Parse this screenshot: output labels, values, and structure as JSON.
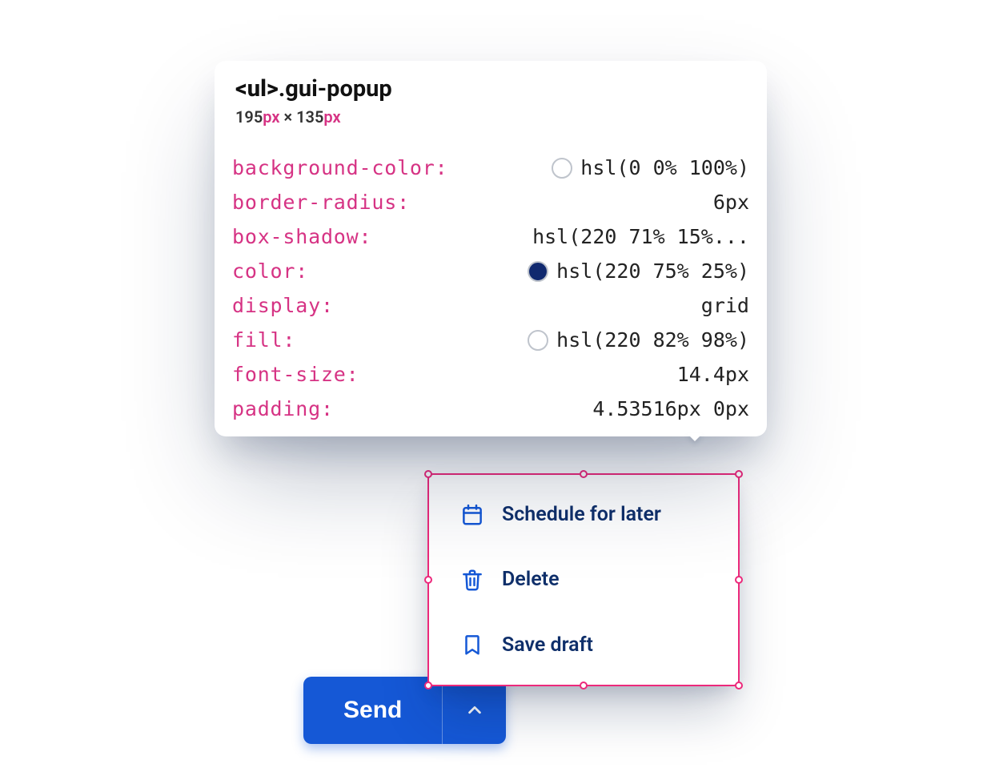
{
  "tooltip": {
    "element_tag": "<ul>",
    "element_class": ".gui-popup",
    "width_num": "195",
    "height_num": "135",
    "px_label": "px",
    "sep": " × ",
    "styles": [
      {
        "prop": "background-color",
        "value": "hsl(0 0% 100%)",
        "swatch": "#ffffff"
      },
      {
        "prop": "border-radius",
        "value": "6px"
      },
      {
        "prop": "box-shadow",
        "value": "hsl(220 71% 15%..."
      },
      {
        "prop": "color",
        "value": "hsl(220 75% 25%)",
        "swatch": "#10296f"
      },
      {
        "prop": "display",
        "value": "grid"
      },
      {
        "prop": "fill",
        "value": "hsl(220 82% 98%)",
        "swatch": "#f6f9fe"
      },
      {
        "prop": "font-size",
        "value": "14.4px"
      },
      {
        "prop": "padding",
        "value": "4.53516px 0px"
      }
    ]
  },
  "popup": {
    "items": [
      {
        "icon": "calendar-icon",
        "label": "Schedule for later"
      },
      {
        "icon": "trash-icon",
        "label": "Delete"
      },
      {
        "icon": "bookmark-icon",
        "label": "Save draft"
      }
    ]
  },
  "send": {
    "label": "Send"
  },
  "colors": {
    "accent": "#1558d6",
    "ink": "#0f2f6a",
    "pink": "#d63384",
    "outline": "#ec297b"
  }
}
